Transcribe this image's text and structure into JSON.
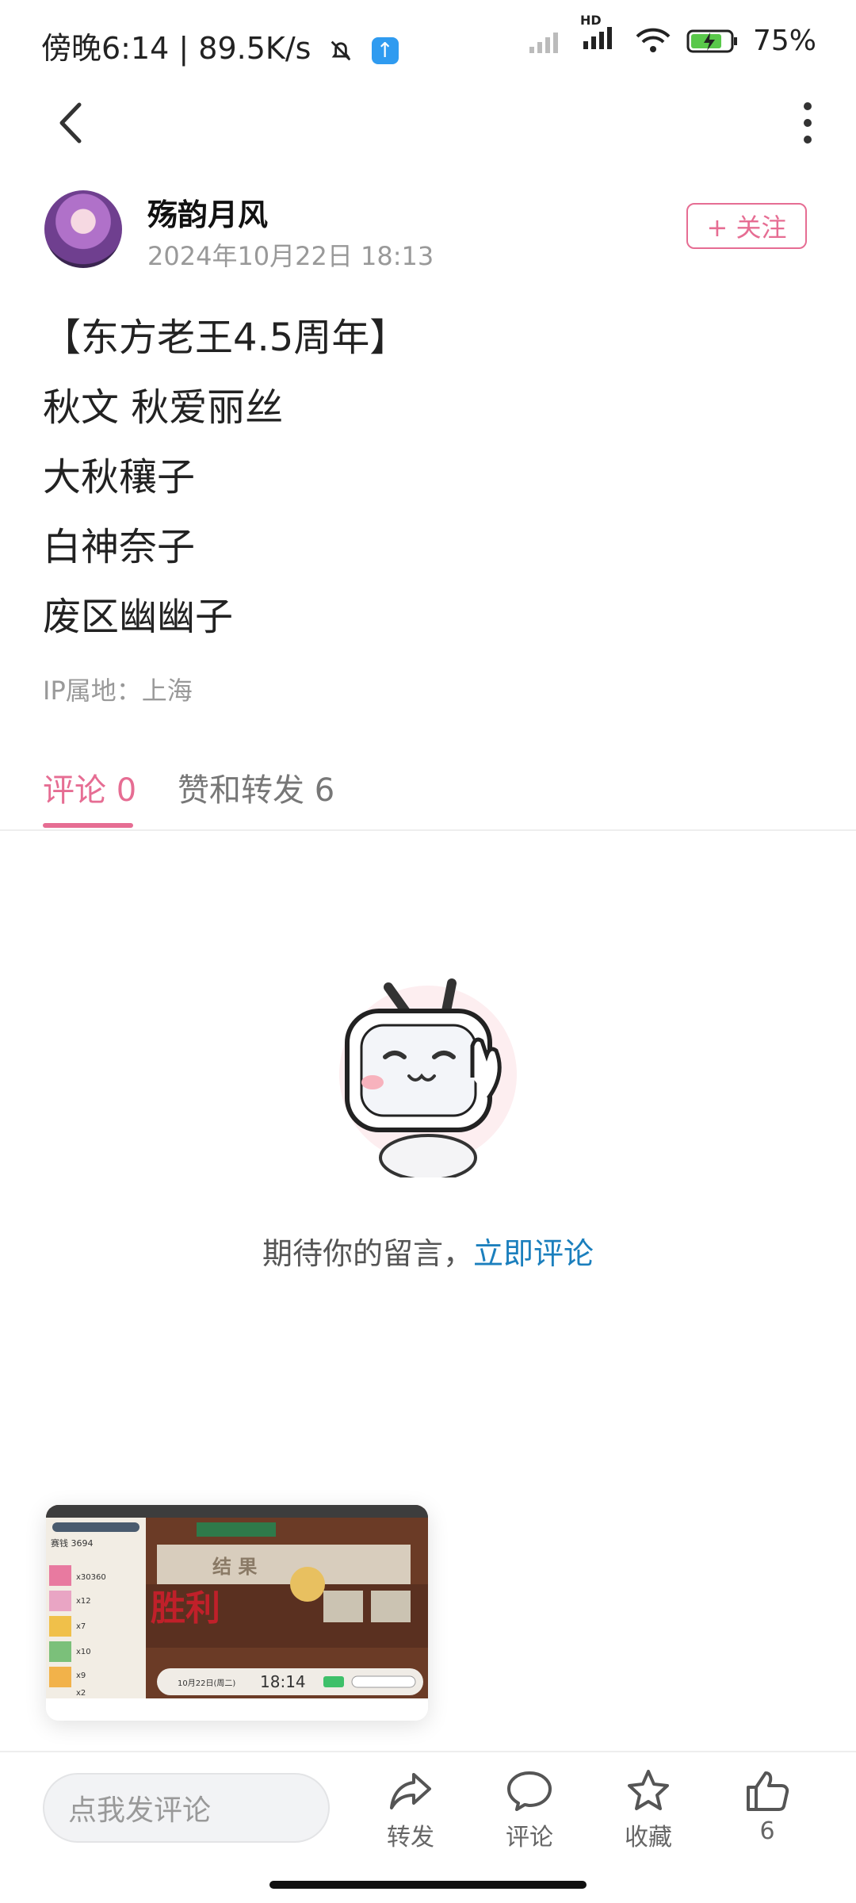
{
  "status_bar": {
    "time_text": "傍晚6:14 | 89.5K/s",
    "battery": "75%",
    "network": "HD"
  },
  "nav": {
    "back_icon": "chevron-left-icon",
    "more_icon": "more-vertical-icon"
  },
  "author": {
    "name": "殇韵月风",
    "time": "2024年10月22日 18:13",
    "follow_label": "+ 关注"
  },
  "post": {
    "lines": [
      "【东方老王4.5周年】",
      "秋文 秋爱丽丝",
      "大秋穰子",
      "白神奈子",
      "废区幽幽子"
    ],
    "ip": "IP属地：上海"
  },
  "tabs": {
    "comments": "评论 0",
    "likes": "赞和转发 6"
  },
  "empty": {
    "text": "期待你的留言，",
    "link": "立即评论"
  },
  "pip": {
    "result": "结 果",
    "victory": "胜利",
    "time": "18:14",
    "date": "10月22日(周二)",
    "currency_label": "赛钱",
    "currency_value": "3694",
    "items": [
      "x30360",
      "x12",
      "x7",
      "x10",
      "x9",
      "x2"
    ]
  },
  "bottom_bar": {
    "input_placeholder": "点我发评论",
    "share": "转发",
    "comment": "评论",
    "favorite": "收藏",
    "like": "6"
  },
  "colors": {
    "accent": "#e66d93",
    "link": "#1b7fbd"
  }
}
